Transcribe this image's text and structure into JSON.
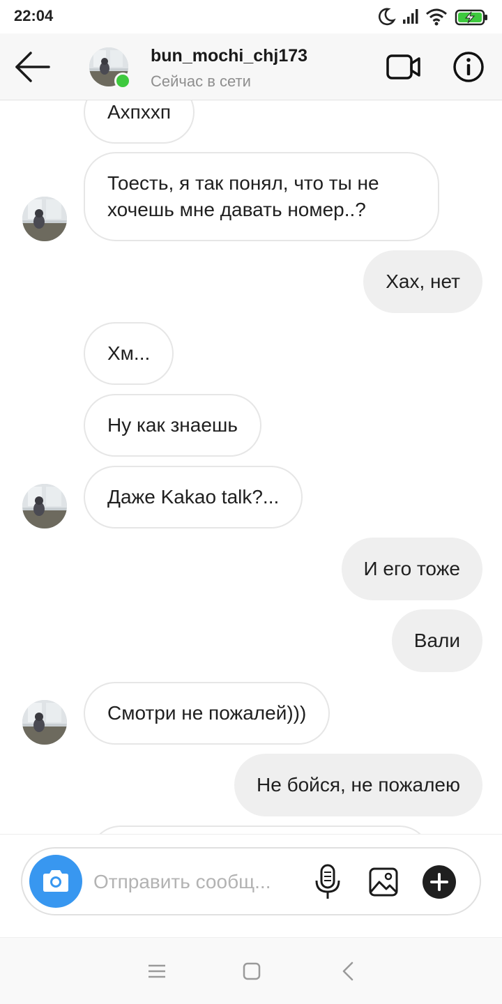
{
  "status_bar": {
    "time": "22:04",
    "icons": [
      "do-not-disturb-moon-icon",
      "signal-icon",
      "wifi-icon",
      "battery-charging-icon"
    ],
    "battery_color": "#3ec93e"
  },
  "header": {
    "username": "bun_mochi_chj173",
    "status": "Сейчас в сети",
    "online_dot_color": "#3ec93e"
  },
  "messages": [
    {
      "side": "in",
      "text": "Ахпххп",
      "avatar": false
    },
    {
      "side": "in",
      "text": "Тоесть, я так понял, что ты не хочешь мне давать номер..?",
      "avatar": true
    },
    {
      "side": "out",
      "text": "Хах, нет"
    },
    {
      "side": "in",
      "text": "Хм...",
      "avatar": false
    },
    {
      "side": "in",
      "text": "Ну как знаешь",
      "avatar": false
    },
    {
      "side": "in",
      "text": "Даже Kakao talk?...",
      "avatar": true
    },
    {
      "side": "out",
      "text": "И его тоже"
    },
    {
      "side": "out",
      "text": "Вали"
    },
    {
      "side": "in",
      "text": "Смотри не пожалей)))",
      "avatar": true
    },
    {
      "side": "out",
      "text": "Не бойся, не пожалею"
    }
  ],
  "composer": {
    "placeholder": "Отправить сообщ...",
    "value": "",
    "accent_color": "#3897f0"
  },
  "nav": {
    "icons": [
      "menu-icon",
      "home-square-icon",
      "back-chevron-icon"
    ]
  }
}
